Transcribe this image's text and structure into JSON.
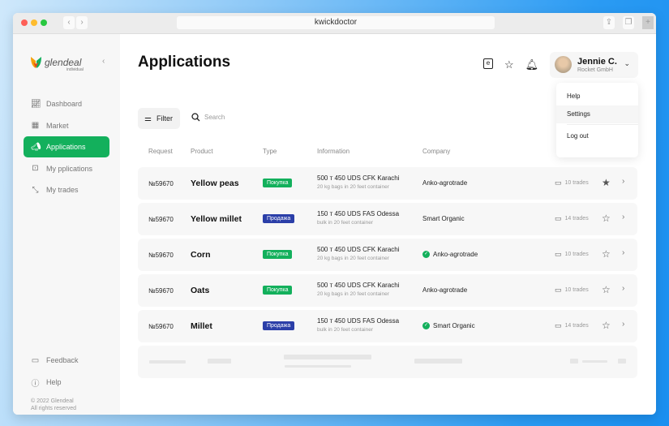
{
  "browser": {
    "url": "kwickdoctor"
  },
  "sidebar": {
    "logo": "glendeal",
    "logo_sub": "individual",
    "collapse_icon": "chevron-left-icon",
    "items": [
      {
        "label": "Dashboard",
        "icon": "chart-icon"
      },
      {
        "label": "Market",
        "icon": "market-icon"
      },
      {
        "label": "Applications",
        "icon": "megaphone-icon",
        "active": true
      },
      {
        "label": "My pplications",
        "icon": "briefcase-icon"
      },
      {
        "label": "My trades",
        "icon": "arrows-icon"
      }
    ],
    "bottom": [
      {
        "label": "Feedback",
        "icon": "feedback-icon"
      },
      {
        "label": "Help",
        "icon": "help-icon"
      }
    ],
    "copyright": "© 2022 Glendeal",
    "rights": "All rights reserved"
  },
  "header": {
    "title": "Applications",
    "user_name": "Jennie C.",
    "user_company": "Rocket GmbH"
  },
  "menu": {
    "items": [
      "Help",
      "Settings",
      "Log out"
    ]
  },
  "toolbar": {
    "filter": "Filter",
    "search_placeholder": "Search"
  },
  "columns": [
    "Request",
    "Product",
    "Type",
    "Information",
    "Company"
  ],
  "colors": {
    "accent": "#13b05c",
    "buy": "#13b05c",
    "sell": "#2b3fa8"
  },
  "rows": [
    {
      "req": "№59670",
      "product": "Yellow peas",
      "type": "Покупка",
      "kind": "buy",
      "info": "500 т 450 UDS CFK Karachi",
      "info2": "20 kg bags in 20 feet container",
      "company": "Anko-agrotrade",
      "verified": false,
      "trades": "10 trades",
      "starred": true
    },
    {
      "req": "№59670",
      "product": "Yellow millet",
      "type": "Продажа",
      "kind": "sell",
      "info": "150 т 450 UDS FAS Odessa",
      "info2": "bulk in 20 feet container",
      "company": "Smart Organic",
      "verified": false,
      "trades": "14 trades",
      "starred": false
    },
    {
      "req": "№59670",
      "product": "Corn",
      "type": "Покупка",
      "kind": "buy",
      "info": "500 т 450 UDS CFK Karachi",
      "info2": "20 kg bags in 20 feet container",
      "company": "Anko-agrotrade",
      "verified": true,
      "trades": "10 trades",
      "starred": false
    },
    {
      "req": "№59670",
      "product": "Oats",
      "type": "Покупка",
      "kind": "buy",
      "info": "500 т 450 UDS CFK Karachi",
      "info2": "20 kg bags in 20 feet container",
      "company": "Anko-agrotrade",
      "verified": false,
      "trades": "10 trades",
      "starred": false
    },
    {
      "req": "№59670",
      "product": "Millet",
      "type": "Продажа",
      "kind": "sell",
      "info": "150 т 450 UDS FAS Odessa",
      "info2": "bulk in 20 feet container",
      "company": "Smart Organic",
      "verified": true,
      "trades": "14 trades",
      "starred": false
    }
  ]
}
